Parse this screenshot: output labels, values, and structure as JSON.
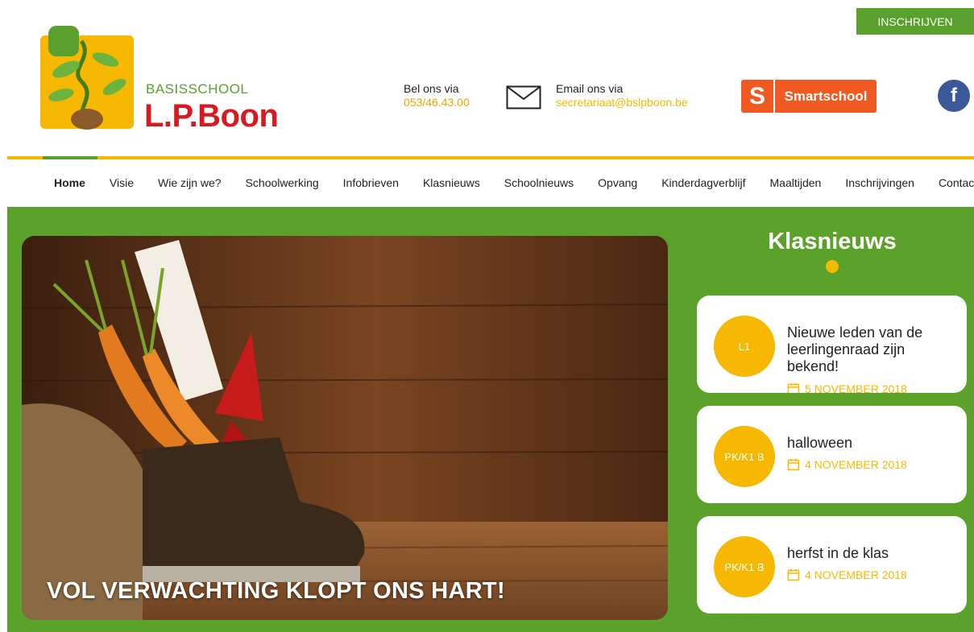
{
  "header": {
    "enroll_button": "INSCHRIJVEN",
    "logo": {
      "subtitle": "BASISSCHOOL",
      "title": "L.P.Boon"
    },
    "call": {
      "label": "Bel ons via",
      "value": "053/46.43.00"
    },
    "mail": {
      "label": "Email ons via",
      "value": "secretariaat@bslpboon.be"
    },
    "smartschool": {
      "letter": "S",
      "name": "Smartschool"
    },
    "facebook_letter": "f"
  },
  "nav": {
    "items": [
      {
        "label": "Home"
      },
      {
        "label": "Visie"
      },
      {
        "label": "Wie zijn we?"
      },
      {
        "label": "Schoolwerking"
      },
      {
        "label": "Infobrieven"
      },
      {
        "label": "Klasnieuws"
      },
      {
        "label": "Schoolnieuws"
      },
      {
        "label": "Opvang"
      },
      {
        "label": "Kinderdagverblijf"
      },
      {
        "label": "Maaltijden"
      },
      {
        "label": "Inschrijvingen"
      },
      {
        "label": "Contact"
      }
    ],
    "active": "Home"
  },
  "hero": {
    "caption": "VOL VERWACHTING KLOPT ONS HART!"
  },
  "sidebar": {
    "title": "Klasnieuws",
    "news": [
      {
        "badge": "L1",
        "title": "Nieuwe leden van de leerlingenraad zijn bekend!",
        "date": "5 NOVEMBER 2018"
      },
      {
        "badge": "PK/K1 B",
        "title": "halloween",
        "date": "4 NOVEMBER 2018"
      },
      {
        "badge": "PK/K1 B",
        "title": "herfst in de klas",
        "date": "4 NOVEMBER 2018"
      }
    ]
  },
  "colors": {
    "brand_green": "#5ba22b",
    "accent_yellow": "#f6b800",
    "logo_red": "#d71920",
    "smartschool_orange": "#f05a22",
    "facebook_blue": "#3b5998"
  }
}
